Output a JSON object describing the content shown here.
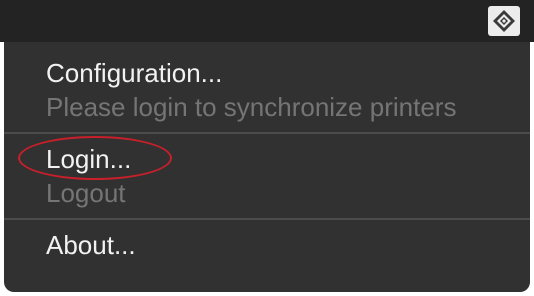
{
  "menubar": {
    "status_icon": "printer-sync-app-icon"
  },
  "menu": {
    "configuration_label": "Configuration...",
    "sync_status_label": "Please login to synchronize printers",
    "login_label": "Login...",
    "logout_label": "Logout",
    "about_label": "About..."
  },
  "colors": {
    "menubar_bg": "#232323",
    "menu_bg": "#313131",
    "enabled_text": "#f2f2f2",
    "disabled_text": "#757575",
    "annotation": "#c8202a"
  }
}
